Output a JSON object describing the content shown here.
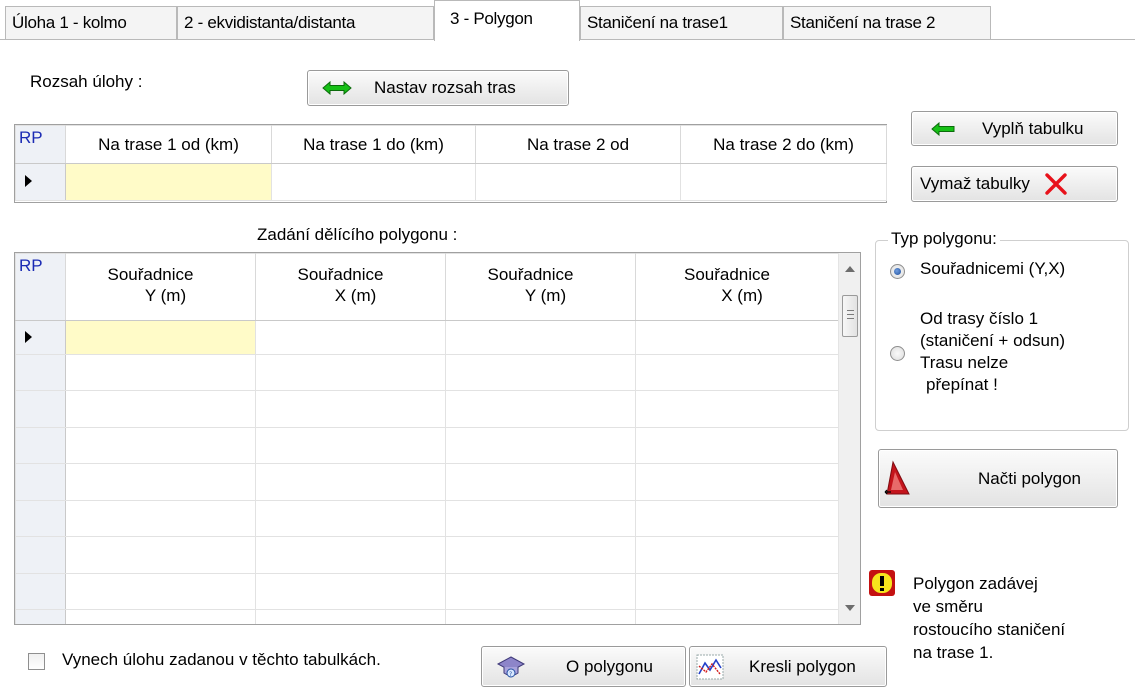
{
  "tabs": [
    "Úloha 1 - kolmo",
    "2 - ekvidistanta/distanta",
    "3 - Polygon",
    "Staničení na trase1",
    "Staničení na trase 2"
  ],
  "range": {
    "label": "Rozsah úlohy :",
    "set_button": "Nastav rozsah tras",
    "headers": [
      "RP",
      "Na trase 1 od (km)",
      "Na trase 1 do (km)",
      "Na trase 2  od",
      "Na trase 2 do (km)"
    ]
  },
  "buttons": {
    "fill_table": "Vyplň tabulku",
    "clear_tables": "Vymaž tabulky",
    "load_polygon": "Načti polygon",
    "about_polygon": "O polygonu",
    "draw_polygon": "Kresli polygon"
  },
  "polygon": {
    "label": "Zadání dělícího polygonu :",
    "headers": [
      {
        "l1": "RP",
        "l2": ""
      },
      {
        "l1": "Souřadnice",
        "l2": "Y (m)"
      },
      {
        "l1": "Souřadnice",
        "l2": "X (m)"
      },
      {
        "l1": "Souřadnice",
        "l2": "Y (m)"
      },
      {
        "l1": "Souřadnice",
        "l2": "X (m)"
      }
    ]
  },
  "polygon_type": {
    "legend": "Typ  polygonu:",
    "opt1": "Souřadnicemi (Y,X)",
    "opt2_lines": [
      "Od trasy číslo 1",
      "(staničení + odsun)",
      "Trasu nelze",
      "přepínat !"
    ]
  },
  "warning_lines": [
    "Polygon zadávej",
    "ve směru",
    "rostoucího staničení",
    "na trase 1."
  ],
  "skip_checkbox": "Vynech úlohu zadanou v těchto tabulkách.",
  "colors": {
    "yellow_cell": "#fffbc8",
    "rp_blue": "#1b2bb4",
    "clear_x": "#e8121b",
    "arrow_green": "#16c016"
  }
}
